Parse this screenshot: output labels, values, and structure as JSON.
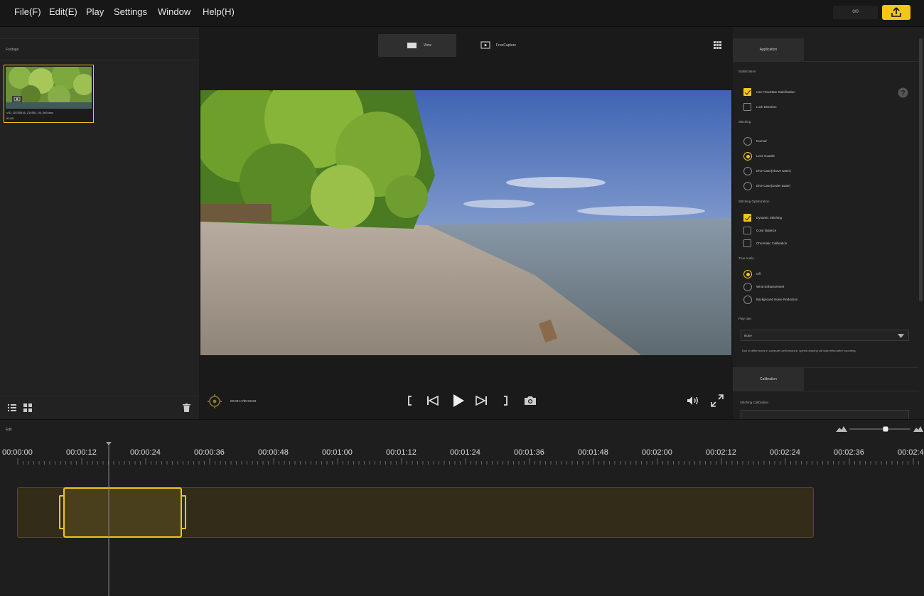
{
  "menu": {
    "items": [
      {
        "label": "File(F)",
        "name": "menu-file"
      },
      {
        "label": "Edit(E)",
        "name": "menu-edit"
      },
      {
        "label": "Play",
        "name": "menu-play"
      },
      {
        "label": "Settings",
        "name": "menu-settings"
      },
      {
        "label": "Window",
        "name": "menu-window"
      },
      {
        "label": "Help(H)",
        "name": "menu-help"
      }
    ],
    "counter": "0/0",
    "export_icon": "upload-icon"
  },
  "footage": {
    "title": "Footage",
    "clip": {
      "filename": "VID_20230516_214551_00_060.insv",
      "duration": "02:50"
    },
    "list_view_icon": "list-view-icon",
    "grid_view_icon": "grid-view-icon",
    "delete_icon": "trash-icon"
  },
  "viewer": {
    "tabs": [
      {
        "label": "View",
        "icon": "view-icon"
      },
      {
        "label": "FreeCapture",
        "icon": "freecapture-icon"
      }
    ],
    "timecode": "00:00:17/00:02:50",
    "controls": [
      "mark-in-icon",
      "previous-icon",
      "play-icon",
      "next-icon",
      "mark-out-icon",
      "snapshot-icon"
    ],
    "volume_icon": "speaker-icon",
    "fullscreen_icon": "fullscreen-icon"
  },
  "settings": {
    "tab_application": "Application",
    "stabilization": {
      "title": "Stabilization",
      "options": [
        {
          "label": "Use FlowState Stabilization",
          "checked": true
        },
        {
          "label": "Lock Direction",
          "checked": false
        }
      ]
    },
    "stitching": {
      "title": "Stitching",
      "options": [
        {
          "label": "Normal",
          "selected": false
        },
        {
          "label": "Lens Guards",
          "selected": true
        },
        {
          "label": "Dive Case(Above water)",
          "selected": false
        },
        {
          "label": "Dive Case(Under water)",
          "selected": false
        }
      ]
    },
    "stitching_optimization": {
      "title": "Stitching Optimization",
      "options": [
        {
          "label": "Dynamic Stitching",
          "checked": true
        },
        {
          "label": "Color Balance",
          "checked": false
        },
        {
          "label": "Chromatic Calibration",
          "checked": false
        }
      ]
    },
    "true_audio": {
      "title": "True Audio",
      "options": [
        {
          "label": "Off",
          "selected": true
        },
        {
          "label": "Wind Enhancement",
          "selected": false
        },
        {
          "label": "Background Noise Reduction",
          "selected": false
        }
      ]
    },
    "play_rate": {
      "title": "Play rate",
      "value": "None",
      "note": "Due to differences in computer performance, speed ramping will take effect after exporting."
    },
    "tab_calibration": "Calibration",
    "stitching_calibration": "Stitching Calibration"
  },
  "timeline": {
    "title": "Edit",
    "ticks": [
      "00:00:00",
      "00:00:12",
      "00:00:24",
      "00:00:36",
      "00:00:48",
      "00:01:00",
      "00:01:12",
      "00:01:24",
      "00:01:36",
      "00:01:48",
      "00:02:00",
      "00:02:12",
      "00:02:24",
      "00:02:36",
      "00:02:4"
    ],
    "zoom_fraction": 0.6,
    "accent": "#f5c518"
  }
}
